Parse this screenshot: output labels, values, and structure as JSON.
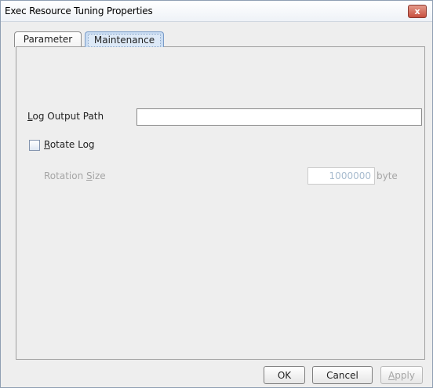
{
  "window": {
    "title": "Exec Resource Tuning Properties",
    "close_label": "x"
  },
  "tabs": [
    {
      "label": "Parameter",
      "selected": false
    },
    {
      "label": "Maintenance",
      "selected": true
    }
  ],
  "maintenance": {
    "log_output_path": {
      "label_mnemonic": "L",
      "label_rest": "og Output Path",
      "value": ""
    },
    "rotate_log": {
      "label_mnemonic": "R",
      "label_rest": "otate Log",
      "checked": false
    },
    "rotation_size": {
      "label_prefix": "Rotation ",
      "label_mnemonic": "S",
      "label_rest": "ize",
      "value": "1000000",
      "unit": "byte",
      "enabled": false
    }
  },
  "buttons": {
    "ok": "OK",
    "cancel": "Cancel",
    "apply_mnemonic": "A",
    "apply_rest": "pply"
  }
}
